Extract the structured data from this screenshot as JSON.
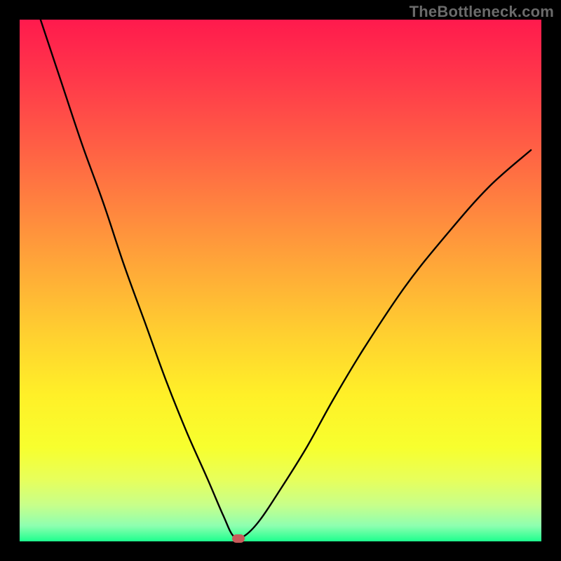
{
  "watermark": "TheBottleneck.com",
  "colors": {
    "frame": "#000000",
    "curve": "#000000",
    "marker": "#c85a5a"
  },
  "chart_data": {
    "type": "line",
    "title": "",
    "xlabel": "",
    "ylabel": "",
    "xlim": [
      0,
      100
    ],
    "ylim": [
      0,
      100
    ],
    "grid": false,
    "legend": false,
    "series": [
      {
        "name": "bottleneck-curve",
        "x": [
          4,
          8,
          12,
          16,
          20,
          24,
          28,
          32,
          36,
          39,
          41,
          43,
          46,
          50,
          55,
          60,
          66,
          74,
          82,
          90,
          98
        ],
        "y": [
          100,
          88,
          76,
          65,
          53,
          42,
          31,
          21,
          12,
          5,
          1,
          1,
          4,
          10,
          18,
          27,
          37,
          49,
          59,
          68,
          75
        ]
      }
    ],
    "annotations": [
      {
        "name": "vertex-marker",
        "x": 42,
        "y": 0.6
      }
    ],
    "background_gradient": {
      "direction": "vertical",
      "stops": [
        {
          "pos": 0.0,
          "color": "#ff1a4d"
        },
        {
          "pos": 0.5,
          "color": "#ffaa38"
        },
        {
          "pos": 0.82,
          "color": "#f7ff2e"
        },
        {
          "pos": 1.0,
          "color": "#1eff8e"
        }
      ]
    }
  }
}
